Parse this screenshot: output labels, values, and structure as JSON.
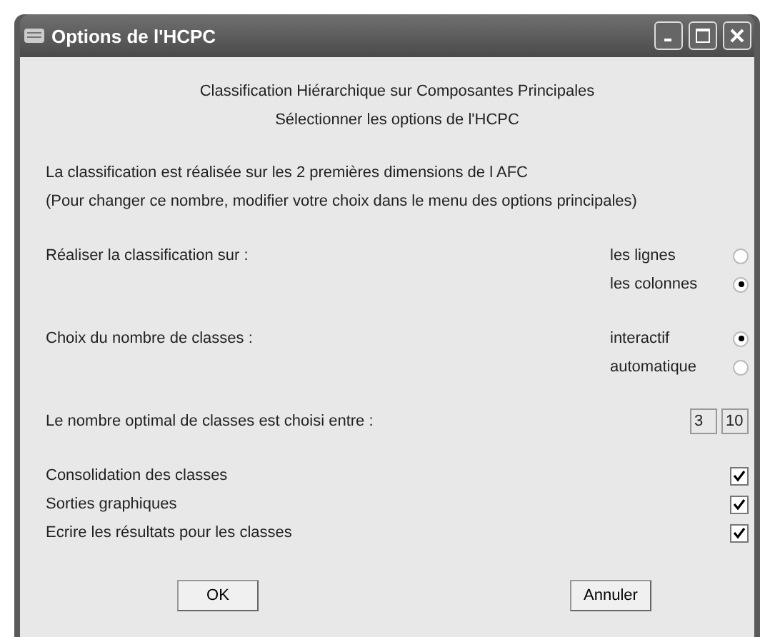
{
  "window": {
    "title": "Options de l'HCPC"
  },
  "heading": [
    "Classification Hiérarchique sur Composantes Principales",
    "Sélectionner les options de l'HCPC"
  ],
  "info": [
    "La classification est réalisée sur les 2 premières dimensions de l AFC",
    "(Pour changer ce nombre, modifier votre choix dans le menu des options principales)"
  ],
  "radio_groups": [
    {
      "label": "Réaliser la classification sur :",
      "options": [
        {
          "label": "les lignes",
          "selected": false
        },
        {
          "label": "les colonnes",
          "selected": true
        }
      ]
    },
    {
      "label": "Choix du nombre de classes :",
      "options": [
        {
          "label": "interactif",
          "selected": true
        },
        {
          "label": "automatique",
          "selected": false
        }
      ]
    }
  ],
  "range": {
    "label": "Le nombre optimal de classes est choisi entre :",
    "min": "3",
    "max": "10"
  },
  "checkboxes": [
    {
      "label": "Consolidation des classes",
      "checked": true
    },
    {
      "label": "Sorties graphiques",
      "checked": true
    },
    {
      "label": "Ecrire les résultats pour les classes",
      "checked": true
    }
  ],
  "buttons": [
    "OK",
    "Annuler"
  ]
}
